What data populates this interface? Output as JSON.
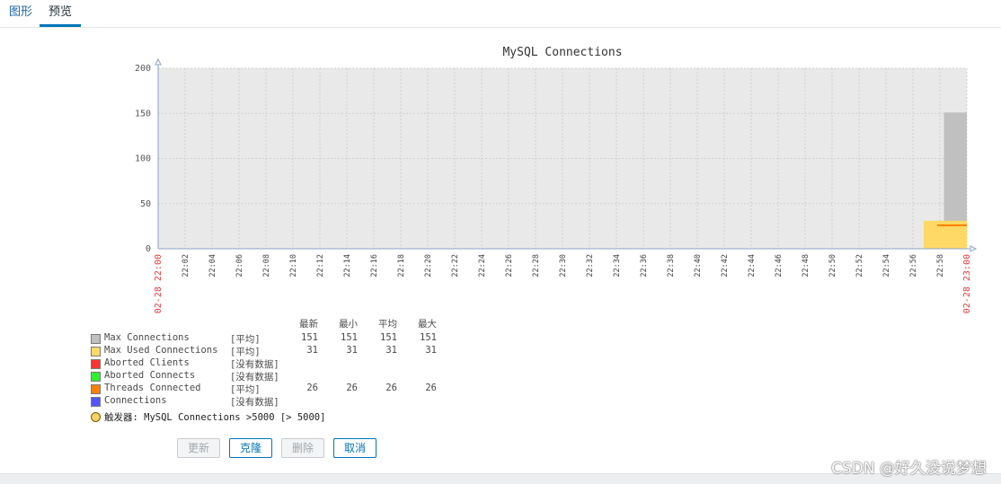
{
  "tabs": {
    "graph": "图形",
    "preview": "预览"
  },
  "chart_data": {
    "type": "area",
    "title": "MySQL Connections",
    "ylim": [
      0,
      200
    ],
    "y_ticks": [
      "0",
      "50",
      "100",
      "150",
      "200"
    ],
    "x_start_label": "02-28 22:00",
    "x_end_label": "02-28 23:00",
    "x_tick_labels": [
      "22:02",
      "22:04",
      "22:06",
      "22:08",
      "22:10",
      "22:12",
      "22:14",
      "22:16",
      "22:18",
      "22:20",
      "22:22",
      "22:24",
      "22:26",
      "22:28",
      "22:30",
      "22:32",
      "22:34",
      "22:36",
      "22:38",
      "22:40",
      "22:42",
      "22:44",
      "22:46",
      "22:48",
      "22:50",
      "22:52",
      "22:54",
      "22:56",
      "22:58"
    ],
    "x_minutes_range": [
      0,
      60
    ],
    "series": [
      {
        "name": "Max Connections",
        "color": "#c0c0c0",
        "x_minutes": [
          58.3,
          60
        ],
        "values": [
          151,
          151
        ]
      },
      {
        "name": "Max Used Connections",
        "color": "#ffd966",
        "x_minutes": [
          56.8,
          60
        ],
        "values": [
          31,
          31
        ]
      },
      {
        "name": "Threads Connected",
        "color": "#ff7f00",
        "x_minutes": [
          57.8,
          60
        ],
        "values": [
          26,
          26
        ]
      }
    ],
    "grid": true,
    "background": "#e9e9e9"
  },
  "legend": {
    "headers": [
      "最新",
      "最小",
      "平均",
      "最大"
    ],
    "rows": [
      {
        "name": "Max Connections",
        "color": "#c0c0c0",
        "fn": "[平均]",
        "last": "151",
        "min": "151",
        "avg": "151",
        "max": "151"
      },
      {
        "name": "Max Used Connections",
        "color": "#ffd966",
        "fn": "[平均]",
        "last": "31",
        "min": "31",
        "avg": "31",
        "max": "31"
      },
      {
        "name": "Aborted Clients",
        "color": "#ff3333",
        "fn": "[没有数据]",
        "last": "",
        "min": "",
        "avg": "",
        "max": ""
      },
      {
        "name": "Aborted Connects",
        "color": "#33ee33",
        "fn": "[没有数据]",
        "last": "",
        "min": "",
        "avg": "",
        "max": ""
      },
      {
        "name": "Threads Connected",
        "color": "#ff7f00",
        "fn": "[平均]",
        "last": "26",
        "min": "26",
        "avg": "26",
        "max": "26"
      },
      {
        "name": "Connections",
        "color": "#5555ff",
        "fn": "[没有数据]",
        "last": "",
        "min": "",
        "avg": "",
        "max": ""
      }
    ],
    "trigger": "触发器: MySQL Connections >5000   [> 5000]"
  },
  "buttons": {
    "update": "更新",
    "clone": "克隆",
    "delete": "删除",
    "cancel": "取消"
  },
  "watermark": "CSDN @好久没说梦想"
}
